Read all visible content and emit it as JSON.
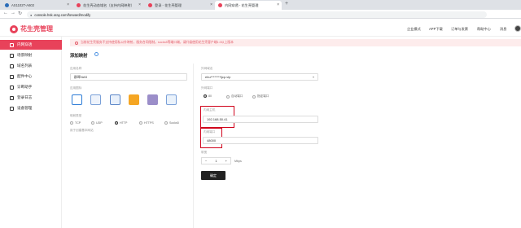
{
  "browser": {
    "tabs": [
      {
        "label": "AS1102T-A602",
        "active": false
      },
      {
        "label": "花生壳动态域名（支持内网映射）",
        "active": false
      },
      {
        "label": "登录 - 花生壳管理",
        "active": false
      },
      {
        "label": "内网穿透 - 花生壳管理",
        "active": true
      }
    ],
    "new_tab": "+",
    "url": "console.hsk.oray.com/forward/modify"
  },
  "header": {
    "logo": "花生壳管理",
    "nav": [
      "企业模式",
      "APP下载",
      "订单与发票",
      "帮助中心",
      "消息"
    ]
  },
  "sidebar": {
    "items": [
      {
        "label": "内网穿透",
        "active": true
      },
      {
        "label": "场景映射",
        "active": false
      },
      {
        "label": "域名列表",
        "active": false
      },
      {
        "label": "配件中心",
        "active": false
      },
      {
        "label": "诊断助手",
        "active": false
      },
      {
        "label": "登录日志",
        "active": false
      },
      {
        "label": "设备管理",
        "active": false
      }
    ]
  },
  "notice": "当前花生壳服务不支持使用私以外映射，服务合同限制。socks5等端口端，请升级使用花生壳客户端1.0以上版本",
  "form": {
    "title": "添加映射",
    "app_name_label": "应用名称",
    "app_name_value": "群晖NAS",
    "app_icon_label": "应用图标",
    "map_type_label": "映射类型",
    "map_types": [
      "TCP",
      "UDP",
      "HTTP",
      "HTTPS",
      "Socks5"
    ],
    "map_type_selected": "HTTP",
    "map_type_hint": "用于创建基本网站",
    "ext_domain_label": "外网域名",
    "ext_domain_value": "ebu********ijcp.vip",
    "ext_port_label": "外网端口",
    "ext_port_options": [
      "80",
      "自动端口",
      "指定端口"
    ],
    "ext_port_selected": "80",
    "internal_ip_label": "内网主机",
    "internal_ip_value": "192.168.50.41",
    "internal_port_label": "内网端口",
    "internal_port_value": "48000",
    "bandwidth_label": "带宽",
    "bandwidth_value": "1",
    "bandwidth_minus": "−",
    "bandwidth_plus": "+",
    "bandwidth_unit": "Mbps",
    "confirm_label": "确定"
  },
  "colors": {
    "brand": "#e8425a",
    "highlight": "#d0021b",
    "notice_bg": "#fdecec"
  }
}
